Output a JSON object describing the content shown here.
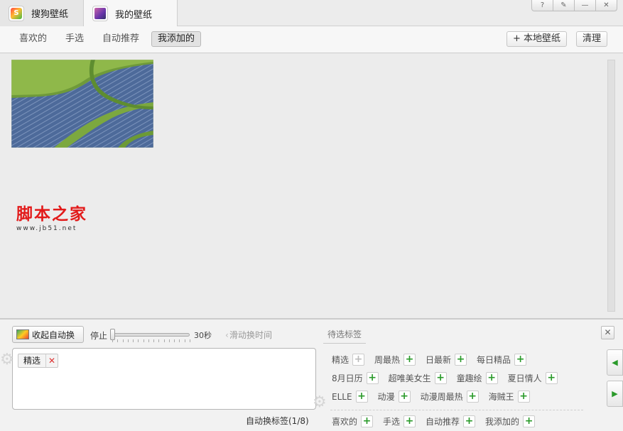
{
  "tabs": [
    {
      "label": "搜狗壁纸",
      "icon": "sogou-logo-icon"
    },
    {
      "label": "我的壁纸",
      "icon": "my-wallpaper-icon"
    }
  ],
  "window_buttons": {
    "help": "?",
    "settings": "✎",
    "minimize": "—",
    "close": "✕"
  },
  "subnav": {
    "items": [
      "喜欢的",
      "手选",
      "自动推荐",
      "我添加的"
    ],
    "active": "我添加的",
    "add_local": "+ 本地壁纸",
    "clear": "清理"
  },
  "watermark": {
    "text": "脚本之家",
    "url": "www.jb51.net"
  },
  "bottom": {
    "collapse_label": "收起自动换",
    "stop_label": "停止",
    "interval_label": "30秒",
    "slider_value_fraction": 0.0,
    "slide_hint": "滑动换时间",
    "pending_title": "待选标签",
    "selected_tags": [
      "精选"
    ],
    "auto_label": "自动换标签(1/8)",
    "tag_rows": [
      [
        {
          "label": "精选",
          "enabled": false
        },
        {
          "label": "周最热",
          "enabled": true
        },
        {
          "label": "日最新",
          "enabled": true
        },
        {
          "label": "每日精品",
          "enabled": true
        }
      ],
      [
        {
          "label": "8月日历",
          "enabled": true
        },
        {
          "label": "超唯美女生",
          "enabled": true
        },
        {
          "label": "童趣绘",
          "enabled": true
        },
        {
          "label": "夏日情人",
          "enabled": true
        }
      ],
      [
        {
          "label": "ELLE",
          "enabled": true
        },
        {
          "label": "动漫",
          "enabled": true
        },
        {
          "label": "动漫周最热",
          "enabled": true
        },
        {
          "label": "海贼王",
          "enabled": true
        }
      ],
      [
        {
          "label": "喜欢的",
          "enabled": true
        },
        {
          "label": "手选",
          "enabled": true
        },
        {
          "label": "自动推荐",
          "enabled": true
        },
        {
          "label": "我添加的",
          "enabled": true
        }
      ]
    ]
  },
  "colors": {
    "accent_green": "#2a9a2a",
    "watermark_red": "#e21a1a"
  }
}
